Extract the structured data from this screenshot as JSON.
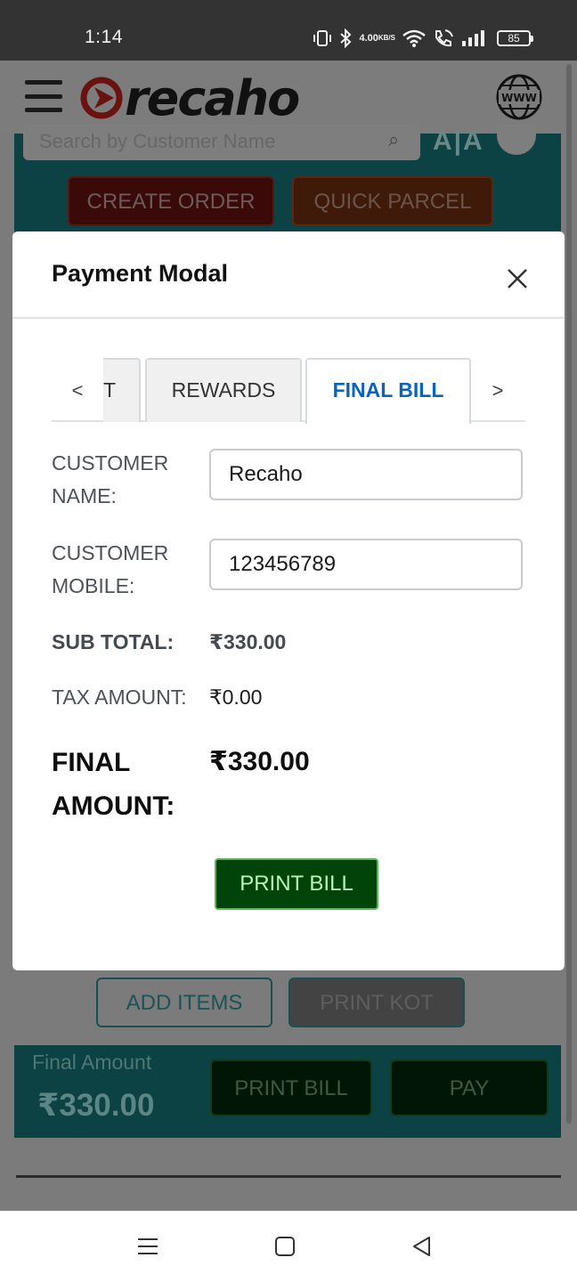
{
  "status_bar": {
    "time": "1:14",
    "net_speed": "4.00",
    "net_speed_unit": "KB/S",
    "battery": "85"
  },
  "app_header": {
    "logo_text": "recaho"
  },
  "background": {
    "search_placeholder": "Search by Customer Name",
    "create_order": "CREATE ORDER",
    "quick_parcel": "QUICK PARCEL",
    "add_items": "ADD ITEMS",
    "print_kot": "PRINT KOT",
    "final_amount_label": "Final Amount",
    "final_amount_value": "₹330.00",
    "print_bill": "PRINT BILL",
    "pay": "PAY"
  },
  "modal": {
    "title": "Payment Modal",
    "tabs": {
      "partial": "T",
      "rewards": "REWARDS",
      "final_bill": "FINAL BILL",
      "active": "FINAL BILL"
    },
    "customer_name_label_1": "CUSTOMER",
    "customer_name_label_2": "NAME:",
    "customer_name": "Recaho",
    "customer_mobile_label_1": "CUSTOMER",
    "customer_mobile_label_2": "MOBILE:",
    "customer_mobile": "123456789",
    "sub_total_label": "SUB TOTAL:",
    "sub_total": "₹330.00",
    "tax_amount_label": "TAX AMOUNT:",
    "tax_amount": "₹0.00",
    "final_amount_label_1": "FINAL",
    "final_amount_label_2": "AMOUNT:",
    "final_amount": "₹330.00",
    "print_bill": "PRINT BILL"
  },
  "colors": {
    "logo_red": "#c0201c",
    "active_tab": "#0a64b8",
    "print_button": "#00440a",
    "teal_background": "#0c4243"
  }
}
